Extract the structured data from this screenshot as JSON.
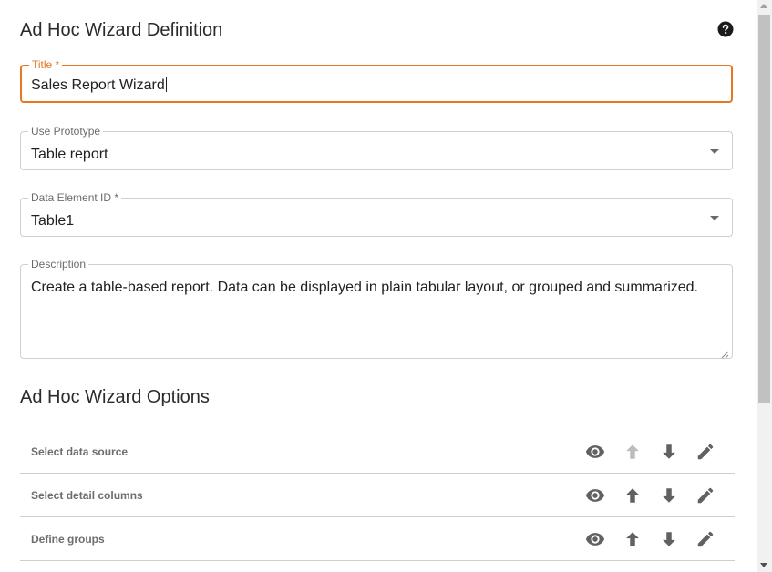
{
  "definition": {
    "heading": "Ad Hoc Wizard Definition",
    "help_icon": "help-circle-icon"
  },
  "form": {
    "title": {
      "label": "Title *",
      "value": "Sales Report Wizard",
      "focused": true,
      "accent_color": "#e87722"
    },
    "use_prototype": {
      "label": "Use Prototype",
      "value": "Table report"
    },
    "data_element_id": {
      "label": "Data Element ID *",
      "value": "Table1"
    },
    "description": {
      "label": "Description",
      "value": "Create a table-based report. Data can be displayed in plain tabular layout, or grouped and summarized."
    }
  },
  "options": {
    "heading": "Ad Hoc Wizard Options",
    "rows": [
      {
        "label": "Select data source",
        "move_up_enabled": false,
        "move_down_enabled": true
      },
      {
        "label": "Select detail columns",
        "move_up_enabled": true,
        "move_down_enabled": true
      },
      {
        "label": "Define groups",
        "move_up_enabled": true,
        "move_down_enabled": true
      }
    ],
    "icons": [
      "eye-icon",
      "arrow-up-icon",
      "arrow-down-icon",
      "pencil-icon"
    ],
    "icon_color": "#616161",
    "disabled_icon_color": "#bdbdbd"
  }
}
